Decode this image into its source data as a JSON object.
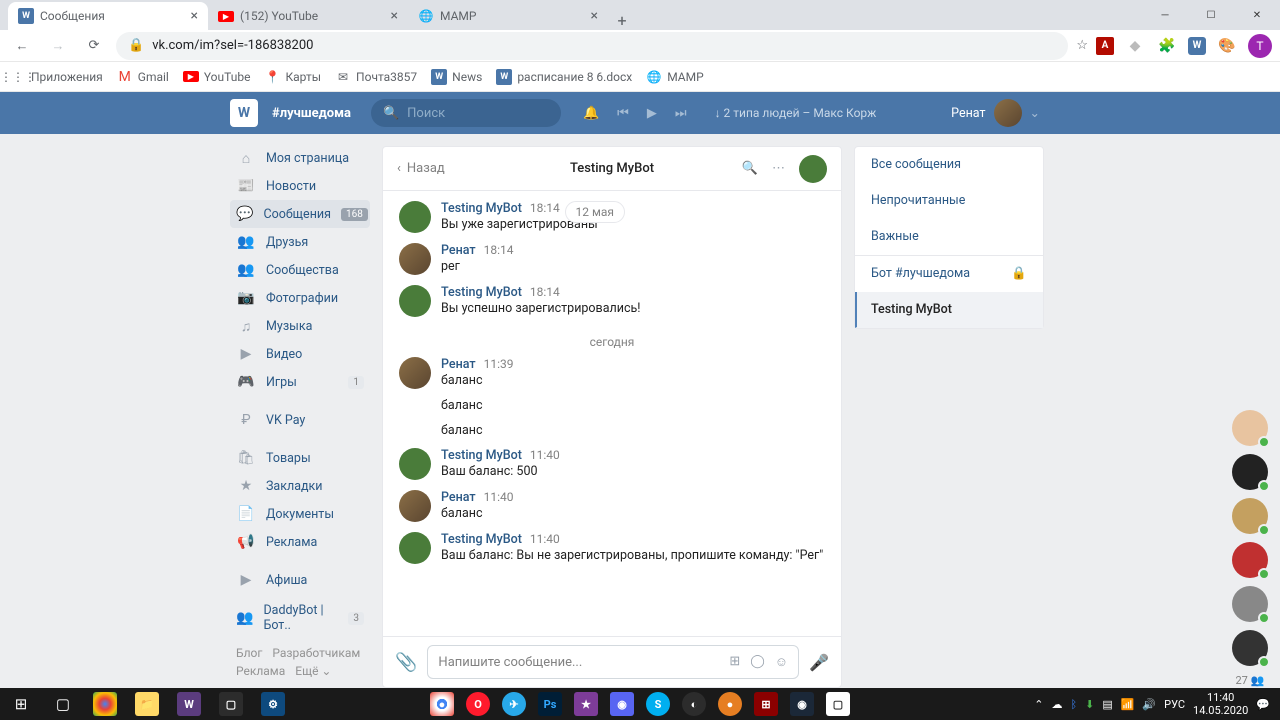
{
  "tabs": [
    {
      "title": "Сообщения"
    },
    {
      "title": "(152) YouTube"
    },
    {
      "title": "MAMP"
    }
  ],
  "url": "vk.com/im?sel=-186838200",
  "avatar_letter": "Т",
  "bookmarks": {
    "apps": "Приложения",
    "gmail": "Gmail",
    "youtube": "YouTube",
    "maps": "Карты",
    "mail": "Почта3857",
    "news": "News",
    "schedule": "расписание 8 6.docx",
    "mamp": "MAMP"
  },
  "vk_header": {
    "hashtag": "#лучшедома",
    "search": "Поиск",
    "track": "↓ 2 типа людей – Макс Корж",
    "user": "Ренат"
  },
  "nav": {
    "mypage": "Моя страница",
    "news": "Новости",
    "messages": "Сообщения",
    "messages_badge": "168",
    "friends": "Друзья",
    "communities": "Сообщества",
    "photos": "Фотографии",
    "music": "Музыка",
    "video": "Видео",
    "games": "Игры",
    "games_badge": "1",
    "vkpay": "VK Pay",
    "goods": "Товары",
    "bookmarks": "Закладки",
    "docs": "Документы",
    "ads": "Реклама",
    "posters": "Афиша",
    "daddybot": "DaddyBot | Бот..",
    "daddybot_badge": "3",
    "blog": "Блог",
    "devs": "Разработчикам",
    "ads2": "Реклама",
    "more": "Ещё"
  },
  "chat": {
    "back": "Назад",
    "title": "Testing MyBot",
    "date_pill": "12 мая",
    "compose_placeholder": "Напишите сообщение...",
    "messages": [
      {
        "author": "Testing MyBot",
        "time": "18:14",
        "text": "Вы уже зарегистрированы",
        "avatar": "bot"
      },
      {
        "author": "Ренат",
        "time": "18:14",
        "text": "рег",
        "avatar": "user"
      },
      {
        "author": "Testing MyBot",
        "time": "18:14",
        "text": "Вы успешно зарегистрировались!",
        "avatar": "bot"
      },
      {
        "sep": "сегодня"
      },
      {
        "author": "Ренат",
        "time": "11:39",
        "text": "баланс",
        "extra": [
          "баланс",
          "баланс"
        ],
        "avatar": "user"
      },
      {
        "author": "Testing MyBot",
        "time": "11:40",
        "text": "Ваш баланс: 500",
        "avatar": "bot"
      },
      {
        "author": "Ренат",
        "time": "11:40",
        "text": "баланс",
        "avatar": "user"
      },
      {
        "author": "Testing MyBot",
        "time": "11:40",
        "text": "Ваш баланс: Вы не зарегистрированы, пропишите команду: \"Рег\"",
        "avatar": "bot"
      }
    ]
  },
  "right_panel": {
    "all": "Все сообщения",
    "unread": "Непрочитанные",
    "important": "Важные",
    "bot": "Бот #лучшедома",
    "testing": "Testing MyBot"
  },
  "friends_count": "27",
  "clock": {
    "time": "11:40",
    "date": "14.05.2020"
  },
  "lang": "РУС"
}
